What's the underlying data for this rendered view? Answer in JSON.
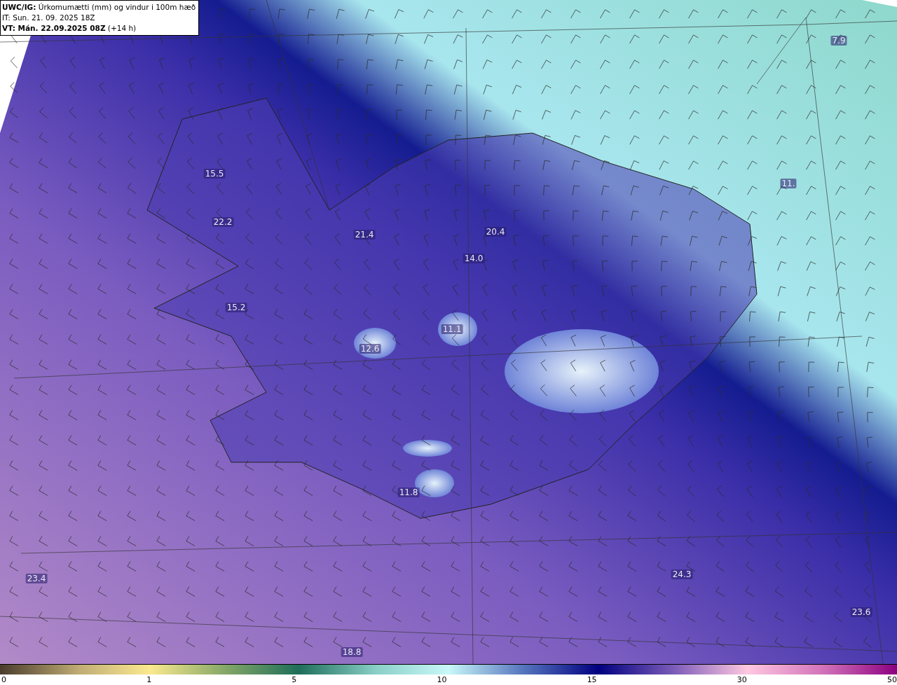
{
  "header": {
    "title": "**UWC/IG:** Úrkomumætti (mm) og vindur i 100m hæð",
    "issue_time": "IT: Sun. 21. 09. 2025 18Z",
    "valid_time": "**VT: Mán. 22.09.2025 08Z** (+14 h)"
  },
  "map_labels": [
    "15.5",
    "22.2",
    "21.4",
    "20.4",
    "14.0",
    "15.2",
    "11.1",
    "12.6",
    "11.8",
    "23.4",
    "24.3",
    "23.6",
    "18.8",
    "7.9",
    "11."
  ],
  "colorbar": {
    "ticks": [
      "0",
      "1",
      "5",
      "10",
      "15",
      "30",
      "50"
    ]
  }
}
